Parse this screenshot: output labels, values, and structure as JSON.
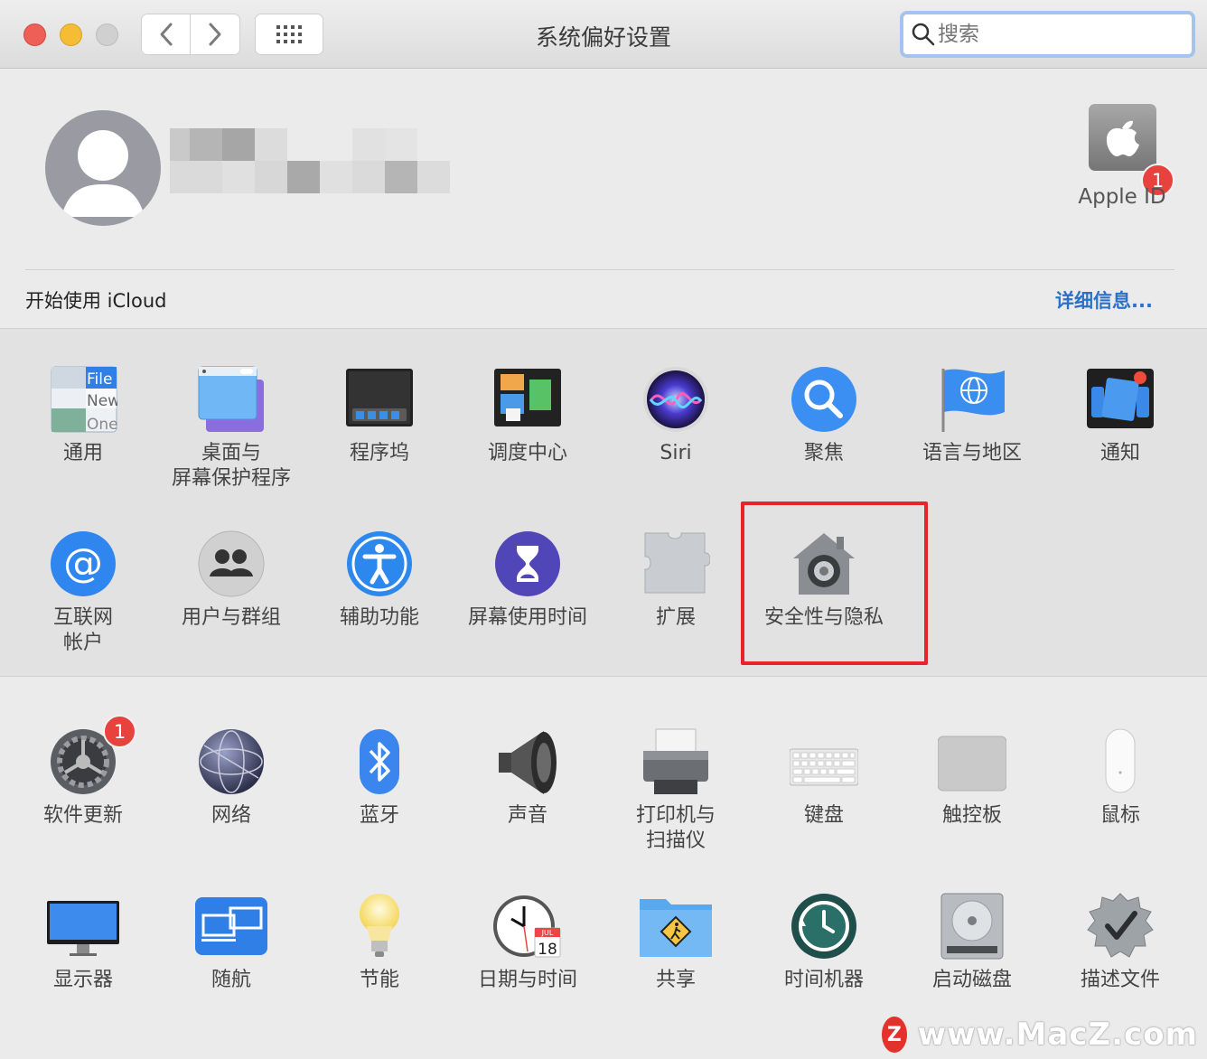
{
  "window": {
    "title": "系统偏好设置",
    "search": {
      "placeholder": "搜索"
    }
  },
  "account": {
    "apple_id_label": "Apple ID",
    "apple_id_badge": "1",
    "icloud_prompt": "开始使用 iCloud",
    "details_link": "详细信息..."
  },
  "panes_row1": [
    {
      "label": "通用",
      "icon": "general-icon"
    },
    {
      "label": "桌面与\n屏幕保护程序",
      "icon": "desktop-screensaver-icon"
    },
    {
      "label": "程序坞",
      "icon": "dock-icon"
    },
    {
      "label": "调度中心",
      "icon": "mission-control-icon"
    },
    {
      "label": "Siri",
      "icon": "siri-icon"
    },
    {
      "label": "聚焦",
      "icon": "spotlight-icon"
    },
    {
      "label": "语言与地区",
      "icon": "language-region-icon"
    },
    {
      "label": "通知",
      "icon": "notifications-icon"
    }
  ],
  "panes_row2": [
    {
      "label": "互联网\n帐户",
      "icon": "internet-accounts-icon"
    },
    {
      "label": "用户与群组",
      "icon": "users-groups-icon"
    },
    {
      "label": "辅助功能",
      "icon": "accessibility-icon"
    },
    {
      "label": "屏幕使用时间",
      "icon": "screen-time-icon"
    },
    {
      "label": "扩展",
      "icon": "extensions-icon"
    },
    {
      "label": "安全性与隐私",
      "icon": "security-privacy-icon"
    }
  ],
  "panes_row3": [
    {
      "label": "软件更新",
      "icon": "software-update-icon",
      "badge": "1"
    },
    {
      "label": "网络",
      "icon": "network-icon"
    },
    {
      "label": "蓝牙",
      "icon": "bluetooth-icon"
    },
    {
      "label": "声音",
      "icon": "sound-icon"
    },
    {
      "label": "打印机与\n扫描仪",
      "icon": "printers-scanners-icon"
    },
    {
      "label": "键盘",
      "icon": "keyboard-icon"
    },
    {
      "label": "触控板",
      "icon": "trackpad-icon"
    },
    {
      "label": "鼠标",
      "icon": "mouse-icon"
    }
  ],
  "panes_row4": [
    {
      "label": "显示器",
      "icon": "displays-icon"
    },
    {
      "label": "随航",
      "icon": "sidecar-icon"
    },
    {
      "label": "节能",
      "icon": "energy-saver-icon"
    },
    {
      "label": "日期与时间",
      "icon": "date-time-icon",
      "date_month": "JUL",
      "date_day": "18"
    },
    {
      "label": "共享",
      "icon": "sharing-icon"
    },
    {
      "label": "时间机器",
      "icon": "time-machine-icon"
    },
    {
      "label": "启动磁盘",
      "icon": "startup-disk-icon"
    },
    {
      "label": "描述文件",
      "icon": "profiles-icon"
    }
  ],
  "general_icon_text": [
    "File",
    "New",
    "One"
  ],
  "watermark": {
    "logo": "Z",
    "text": "www.MacZ.com"
  },
  "colors": {
    "highlight": "#e8232b",
    "link": "#2b71c9",
    "badge": "#e8423f"
  }
}
